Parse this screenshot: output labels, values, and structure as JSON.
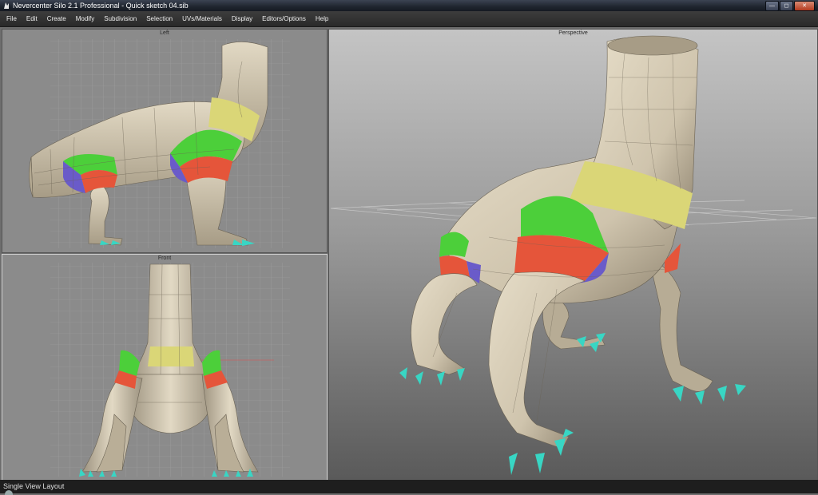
{
  "window": {
    "title": "Nevercenter Silo 2.1 Professional - Quick sketch 04.sib",
    "buttons": [
      "minimize",
      "maximize",
      "close"
    ]
  },
  "menu": [
    "File",
    "Edit",
    "Create",
    "Modify",
    "Subdivision",
    "Selection",
    "UVs/Materials",
    "Display",
    "Editors/Options",
    "Help"
  ],
  "viewports": {
    "left": "Left",
    "front": "Front",
    "perspective": "Perspective"
  },
  "status": {
    "text": "Single View Layout"
  },
  "colors": {
    "mesh": "#d7cdb7",
    "mesh_shadow": "#9d9380",
    "band_green": "#4ccf3a",
    "band_red": "#e5553a",
    "band_yellow": "#dad677",
    "band_blue": "#6a5bc9",
    "claw": "#38d6c4"
  }
}
